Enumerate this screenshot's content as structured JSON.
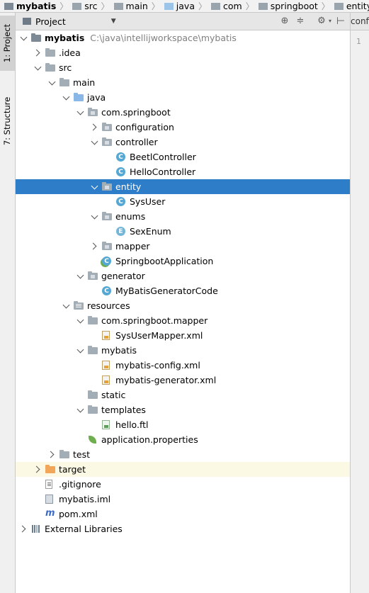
{
  "breadcrumbs": [
    {
      "label": "mybatis",
      "icon": "project-icon",
      "bold": true
    },
    {
      "label": "src",
      "icon": "folder-icon"
    },
    {
      "label": "main",
      "icon": "folder-icon"
    },
    {
      "label": "java",
      "icon": "source-folder-icon"
    },
    {
      "label": "com",
      "icon": "folder-icon"
    },
    {
      "label": "springboot",
      "icon": "folder-icon"
    },
    {
      "label": "entity",
      "icon": "folder-icon"
    }
  ],
  "stripe": {
    "project_tab": "1: Project",
    "structure_tab": "7: Structure"
  },
  "project_panel": {
    "title": "Project"
  },
  "editor": {
    "tab_label": "confi",
    "line_number": "1"
  },
  "colors": {
    "selection": "#2d7dc9",
    "ignored_bg": "#fbf9e4",
    "source_folder": "#8ab8e6",
    "excluded_folder": "#f2a65a"
  },
  "tree": [
    {
      "label": "mybatis",
      "path": "C:\\java\\intellijworkspace\\mybatis",
      "depth": 0,
      "state": "down",
      "icon": "project-module-icon",
      "bold": true
    },
    {
      "label": ".idea",
      "depth": 1,
      "state": "right",
      "icon": "folder-icon"
    },
    {
      "label": "src",
      "depth": 1,
      "state": "down",
      "icon": "folder-icon"
    },
    {
      "label": "main",
      "depth": 2,
      "state": "down",
      "icon": "folder-icon"
    },
    {
      "label": "java",
      "depth": 3,
      "state": "down",
      "icon": "source-folder-icon"
    },
    {
      "label": "com.springboot",
      "depth": 4,
      "state": "down",
      "icon": "package-icon"
    },
    {
      "label": "configuration",
      "depth": 5,
      "state": "right",
      "icon": "package-icon"
    },
    {
      "label": "controller",
      "depth": 5,
      "state": "down",
      "icon": "package-icon"
    },
    {
      "label": "BeetlController",
      "depth": 6,
      "state": "none",
      "icon": "class-icon"
    },
    {
      "label": "HelloController",
      "depth": 6,
      "state": "none",
      "icon": "class-icon"
    },
    {
      "label": "entity",
      "depth": 5,
      "state": "down",
      "icon": "package-icon",
      "selected": true
    },
    {
      "label": "SysUser",
      "depth": 6,
      "state": "none",
      "icon": "class-icon"
    },
    {
      "label": "enums",
      "depth": 5,
      "state": "down",
      "icon": "package-icon"
    },
    {
      "label": "SexEnum",
      "depth": 6,
      "state": "none",
      "icon": "enum-icon"
    },
    {
      "label": "mapper",
      "depth": 5,
      "state": "right",
      "icon": "package-icon"
    },
    {
      "label": "SpringbootApplication",
      "depth": 5,
      "state": "none",
      "icon": "spring-class-icon"
    },
    {
      "label": "generator",
      "depth": 4,
      "state": "down",
      "icon": "package-icon"
    },
    {
      "label": "MyBatisGeneratorCode",
      "depth": 5,
      "state": "none",
      "icon": "class-icon"
    },
    {
      "label": "resources",
      "depth": 3,
      "state": "down",
      "icon": "resources-folder-icon"
    },
    {
      "label": "com.springboot.mapper",
      "depth": 4,
      "state": "down",
      "icon": "folder-icon"
    },
    {
      "label": "SysUserMapper.xml",
      "depth": 5,
      "state": "none",
      "icon": "xml-file-icon"
    },
    {
      "label": "mybatis",
      "depth": 4,
      "state": "down",
      "icon": "folder-icon"
    },
    {
      "label": "mybatis-config.xml",
      "depth": 5,
      "state": "none",
      "icon": "xml-file-icon"
    },
    {
      "label": "mybatis-generator.xml",
      "depth": 5,
      "state": "none",
      "icon": "xml-file-icon"
    },
    {
      "label": "static",
      "depth": 4,
      "state": "none",
      "icon": "folder-icon"
    },
    {
      "label": "templates",
      "depth": 4,
      "state": "down",
      "icon": "folder-icon"
    },
    {
      "label": "hello.ftl",
      "depth": 5,
      "state": "none",
      "icon": "ftl-file-icon"
    },
    {
      "label": "application.properties",
      "depth": 4,
      "state": "none",
      "icon": "spring-properties-icon"
    },
    {
      "label": "test",
      "depth": 2,
      "state": "right",
      "icon": "folder-icon"
    },
    {
      "label": "target",
      "depth": 1,
      "state": "right",
      "icon": "excluded-folder-icon",
      "ignored": true
    },
    {
      "label": ".gitignore",
      "depth": 1,
      "state": "none",
      "icon": "text-file-icon"
    },
    {
      "label": "mybatis.iml",
      "depth": 1,
      "state": "none",
      "icon": "iml-file-icon"
    },
    {
      "label": "pom.xml",
      "depth": 1,
      "state": "none",
      "icon": "maven-pom-icon"
    },
    {
      "label": "External Libraries",
      "depth": 0,
      "state": "right",
      "icon": "libraries-icon"
    }
  ]
}
